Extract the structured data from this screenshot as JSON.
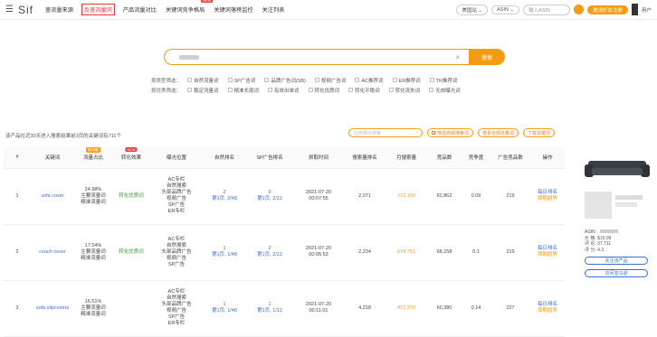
{
  "app": {
    "logo": "Sif"
  },
  "nav": [
    {
      "label": "查流量来源",
      "active": false,
      "new": false
    },
    {
      "label": "反查流量词",
      "active": true,
      "new": false
    },
    {
      "label": "产品流量对比",
      "active": false,
      "new": false
    },
    {
      "label": "关键词竞争格局",
      "active": false,
      "new": true
    },
    {
      "label": "关键词落榜监控",
      "active": false,
      "new": false
    },
    {
      "label": "关注列表",
      "active": false,
      "new": false
    }
  ],
  "new_badge": "NEW",
  "topright": {
    "site": "美国站 ⌄",
    "asin_label": "ASIN ⌄",
    "asin_placeholder": "输入ASIN",
    "upgrade": "邀请好友注册",
    "user": "用户"
  },
  "search": {
    "clear": "×",
    "button": "搜索"
  },
  "filters": {
    "row1_label": "按类型筛选：",
    "row1": [
      "自然流量词",
      "SP广告词",
      "品牌广告词(SB)",
      "视频广告词",
      "AC推荐词",
      "ER推荐词",
      "TR推荐词"
    ],
    "row2_label": "按优秀筛选：",
    "row2": [
      "稳定流量词",
      "精准长尾词",
      "有效出单词",
      "转化优质词",
      "转化平稳词",
      "转化流失词",
      "无效曝光词"
    ]
  },
  "summary": "该产品在近30天进入搜索结果前3页的关键词有711个",
  "toolbar": {
    "search_placeholder": "在结果中搜索",
    "btn1": "筛选高频搜索词",
    "btn2": "查看全部流量词",
    "btn3": "下载关键词"
  },
  "table": {
    "headers": [
      "#",
      "关键词",
      "流量占比",
      "转化效果",
      "曝光位置",
      "自然排名",
      "SP广告排名",
      "抓取时间",
      "搜索量排名",
      "月搜索量",
      "竞品数",
      "竞争度",
      "广告竞品数",
      "操作"
    ],
    "header_badges": {
      "2": "新功能",
      "3": "NEW"
    },
    "rows": [
      {
        "idx": "1",
        "keyword": "sofa cover",
        "traffic": [
          "24.98%",
          "主要流量词",
          "精准流量词"
        ],
        "conversion": "转化优质词",
        "exposure": [
          "AC专栏",
          "自然搜索",
          "头部品牌广告",
          "视频广告",
          "SP广告",
          "ER专栏"
        ],
        "natural": [
          "2",
          "第1页, 2/48"
        ],
        "sp": [
          "0",
          "第1页, 2/12"
        ],
        "time": [
          "2021-07-20",
          "00:07:55"
        ],
        "search_rank": "2,071",
        "monthly": "712,150",
        "competitors": "62,862",
        "competition": "0.09",
        "ad_competitors": "219",
        "ops": [
          "每日排名",
          "周期趋势"
        ]
      },
      {
        "idx": "2",
        "keyword": "couch cover",
        "traffic": [
          "17.54%",
          "主要流量词",
          "精准流量词"
        ],
        "conversion": "转化优质词",
        "exposure": [
          "AC专栏",
          "自然搜索",
          "头部品牌广告",
          "视频广告",
          "SP广告"
        ],
        "natural": [
          "1",
          "第1页, 1/48"
        ],
        "sp": [
          "2",
          "第1页, 2/12"
        ],
        "time": [
          "2021-07-20",
          "00:05:53"
        ],
        "search_rank": "2,234",
        "monthly": "674,753",
        "competitors": "68,158",
        "competition": "0.1",
        "ad_competitors": "219",
        "ops": [
          "每日排名",
          "周期趋势"
        ]
      },
      {
        "idx": "3",
        "keyword": "sofa slipcovers",
        "traffic": [
          "16.51%",
          "主要流量词",
          "精准流量词"
        ],
        "conversion": "",
        "exposure": [
          "AC专栏",
          "自然搜索",
          "头部品牌广告",
          "视频广告",
          "SP广告",
          "ER专栏"
        ],
        "natural": [
          "1",
          "第1页, 1/48"
        ],
        "sp": [
          "1",
          "第1页, 1/12"
        ],
        "time": [
          "2021-07-20",
          "00:11:01"
        ],
        "search_rank": "4,218",
        "monthly": "417,376",
        "competitors": "60,380",
        "competition": "0.14",
        "ad_competitors": "227",
        "ops": [
          "每日排名",
          "周期趋势"
        ]
      }
    ]
  },
  "product": {
    "asin_label": "ASIN：",
    "price": "价 格: $16.99",
    "reviews": "评 论: 37,711",
    "rating": "评 分: 4.3",
    "btn1": "关注该产品",
    "btn2": "访问亚马逊"
  }
}
